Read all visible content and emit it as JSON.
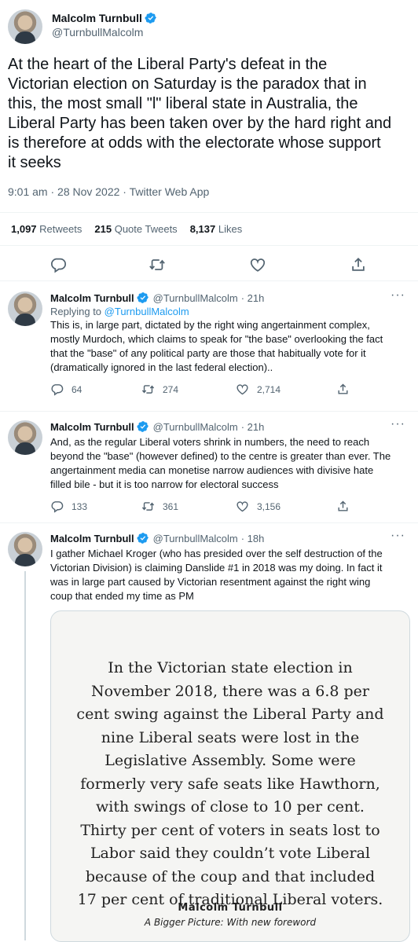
{
  "main_tweet": {
    "author_name": "Malcolm Turnbull",
    "author_handle": "@TurnbullMalcolm",
    "text": "At the heart of the Liberal Party's defeat in the\nVictorian election on Saturday is the paradox that in\nthis, the most small \"l\" liberal state in Australia, the\nLiberal Party has been taken over by the hard right and\nis therefore at odds with the electorate whose support\nit seeks",
    "meta": "9:01 am · 28 Nov 2022 · Twitter Web App",
    "stats": [
      {
        "count": "1,097",
        "label": "Retweets"
      },
      {
        "count": "215",
        "label": "Quote Tweets"
      },
      {
        "count": "8,137",
        "label": "Likes"
      }
    ]
  },
  "replies": [
    {
      "name": "Malcolm Turnbull",
      "handle": "@TurnbullMalcolm",
      "time": "· 21h",
      "replying_prefix": "Replying to",
      "replying_to": "@TurnbullMalcolm",
      "text": "This is, in large part, dictated by the right wing angertainment complex,\nmostly Murdoch, which claims to speak for \"the base\" overlooking the fact\nthat the \"base\" of any political party are those that habitually vote for it\n(dramatically ignored in the last federal election)..",
      "replies": "64",
      "retweets": "274",
      "likes": "2,714"
    },
    {
      "name": "Malcolm Turnbull",
      "handle": "@TurnbullMalcolm",
      "time": "· 21h",
      "text": "And, as the regular Liberal voters shrink in numbers, the need to reach\nbeyond the \"base\" (however defined) to the centre is greater than ever. The\nangertainment media can monetise narrow audiences with divisive hate\nfilled bile - but it is too narrow for electoral success",
      "replies": "133",
      "retweets": "361",
      "likes": "3,156"
    },
    {
      "name": "Malcolm Turnbull",
      "handle": "@TurnbullMalcolm",
      "time": "· 18h",
      "text": "I gather Michael Kroger (who has presided over the self destruction of the\nVictorian Division) is claiming Danslide #1 in 2018 was my doing. In fact it\nwas in large part caused by Victorian resentment against the right wing\ncoup that ended my time as PM"
    }
  ],
  "quote_image": {
    "text": "In the Victorian state election in\nNovember 2018, there was a 6.8 per\ncent swing against the Liberal Party and\nnine Liberal seats were lost in the\nLegislative Assembly. Some were\nformerly very safe seats like Hawthorn,\nwith swings of close to 10 per cent.\nThirty per cent of voters in seats lost to\nLabor said they couldn’t vote Liberal\nbecause of the coup and that included\n17 per cent of traditional Liberal voters.",
    "author": "Malcolm Turnbull",
    "book": "A Bigger Picture: With new foreword"
  },
  "colors": {
    "accent": "#1d9bf0",
    "text": "#0f1419",
    "secondary": "#536471",
    "border": "#eff3f4"
  },
  "icons": [
    "verified-badge-icon",
    "reply-icon",
    "retweet-icon",
    "like-icon",
    "share-icon",
    "more-icon"
  ]
}
